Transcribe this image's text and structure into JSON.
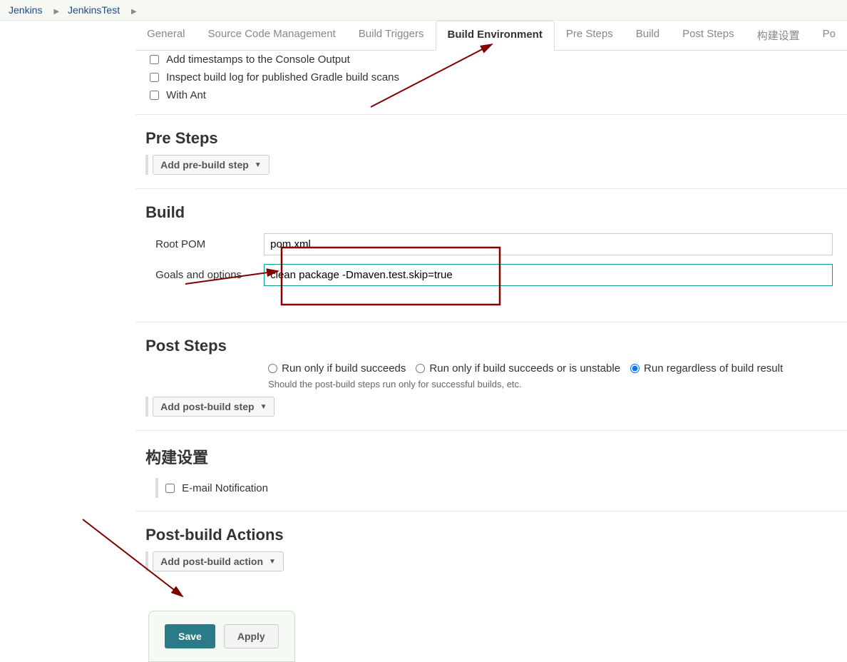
{
  "breadcrumb": {
    "items": [
      "Jenkins",
      "JenkinsTest"
    ]
  },
  "tabs": {
    "general": "General",
    "scm": "Source Code Management",
    "triggers": "Build Triggers",
    "env": "Build Environment",
    "pre": "Pre Steps",
    "build": "Build",
    "post": "Post Steps",
    "cn": "构建设置",
    "po": "Po"
  },
  "buildEnv": {
    "timestamps": "Add timestamps to the Console Output",
    "gradle": "Inspect build log for published Gradle build scans",
    "ant": "With Ant"
  },
  "preSteps": {
    "title": "Pre Steps",
    "btn": "Add pre-build step"
  },
  "build": {
    "title": "Build",
    "rootPomLabel": "Root POM",
    "rootPomValue": "pom.xml",
    "goalsLabel": "Goals and options",
    "goalsValue": "clean package -Dmaven.test.skip=true"
  },
  "postSteps": {
    "title": "Post Steps",
    "r1": "Run only if build succeeds",
    "r2": "Run only if build succeeds or is unstable",
    "r3": "Run regardless of build result",
    "help": "Should the post-build steps run only for successful builds, etc.",
    "btn": "Add post-build step"
  },
  "buildSettings": {
    "title": "构建设置",
    "email": "E-mail Notification"
  },
  "postBuildActions": {
    "title": "Post-build Actions",
    "btn": "Add post-build action"
  },
  "save": {
    "save": "Save",
    "apply": "Apply"
  }
}
